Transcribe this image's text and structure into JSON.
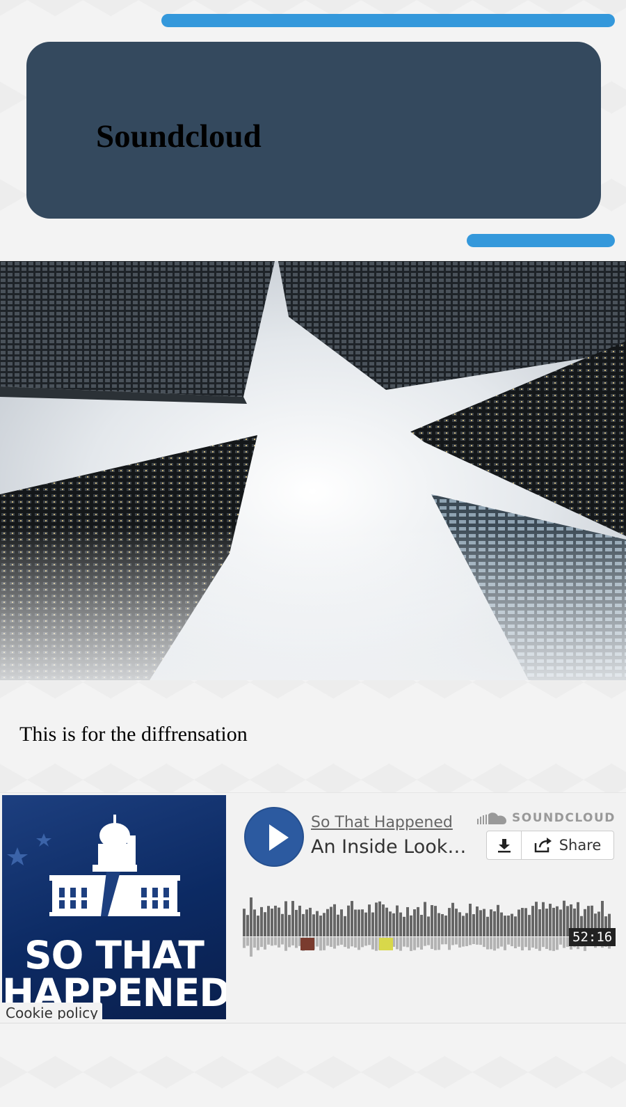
{
  "banner": {
    "title": "Soundcloud"
  },
  "content": {
    "caption": "This is for the diffrensation"
  },
  "player": {
    "artwork_line1": "SO THAT",
    "artwork_line2": "HAPPENED",
    "cookie_label": "Cookie policy",
    "user": "So That Happened",
    "track_title": "An Inside Look…",
    "brand": "SOUNDCLOUD",
    "share_label": "Share",
    "duration": "52:16",
    "icons": [
      "play-icon",
      "soundcloud-logo-icon",
      "download-icon",
      "share-icon"
    ],
    "colors": {
      "accent": "#3498db",
      "banner": "#34495e",
      "play": "#2c5aa0"
    }
  }
}
